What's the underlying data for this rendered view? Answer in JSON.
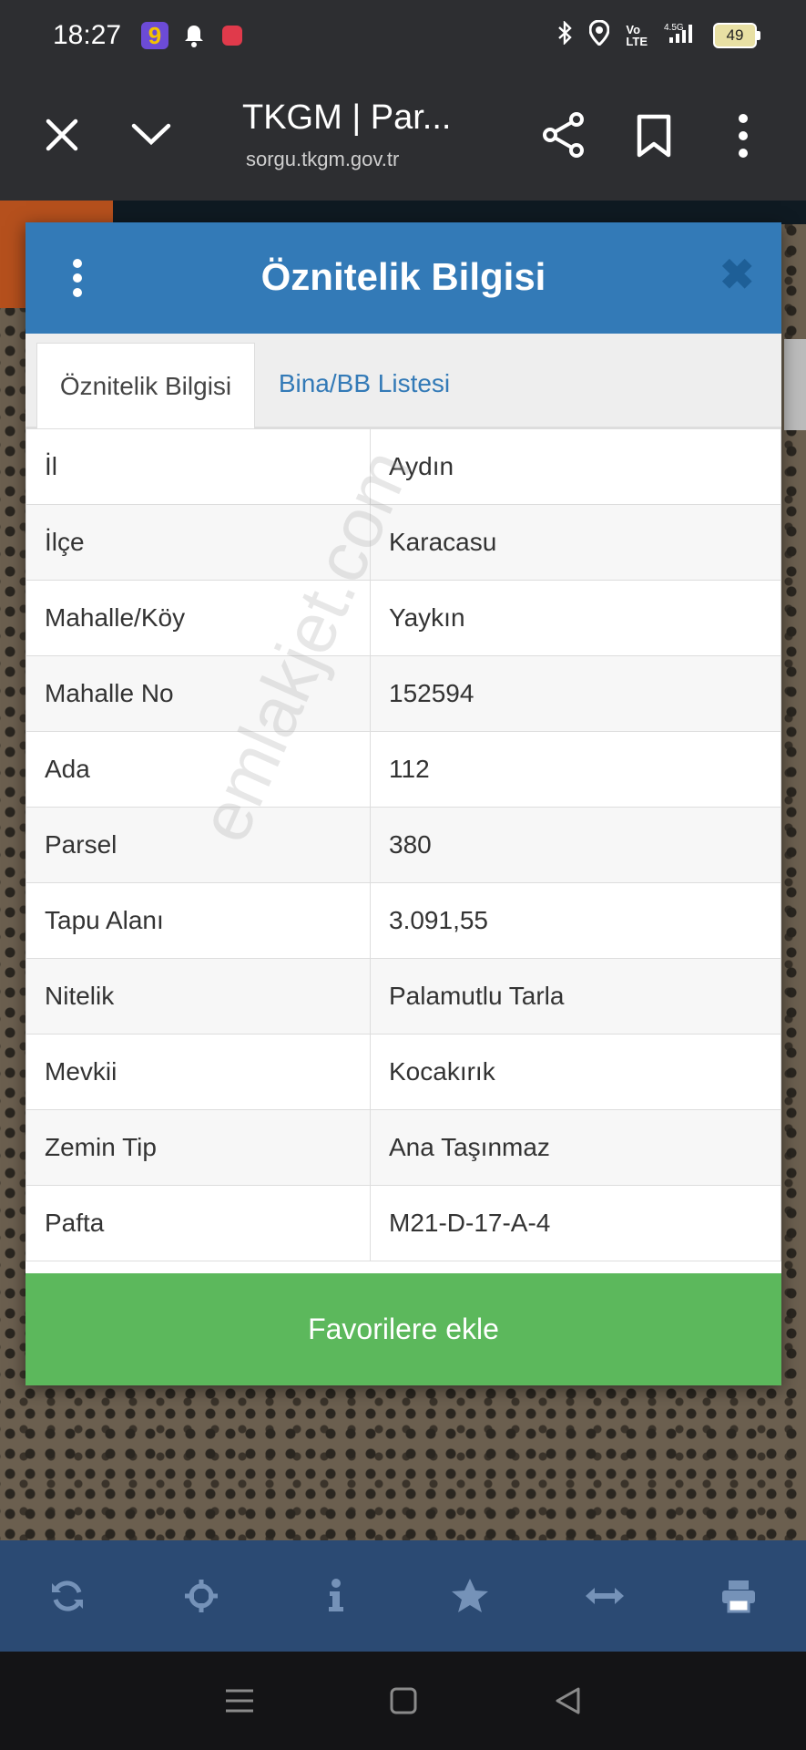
{
  "status": {
    "time": "18:27",
    "battery": "49"
  },
  "browser": {
    "title": "TKGM | Par...",
    "url": "sorgu.tkgm.gov.tr"
  },
  "dialog": {
    "title": "Öznitelik Bilgisi",
    "tabs": [
      {
        "label": "Öznitelik Bilgisi",
        "active": true
      },
      {
        "label": "Bina/BB Listesi",
        "active": false
      }
    ],
    "rows": [
      {
        "key": "İl",
        "value": "Aydın"
      },
      {
        "key": "İlçe",
        "value": "Karacasu"
      },
      {
        "key": "Mahalle/Köy",
        "value": "Yaykın"
      },
      {
        "key": "Mahalle No",
        "value": "152594"
      },
      {
        "key": "Ada",
        "value": "112"
      },
      {
        "key": "Parsel",
        "value": "380"
      },
      {
        "key": "Tapu Alanı",
        "value": "3.091,55"
      },
      {
        "key": "Nitelik",
        "value": "Palamutlu Tarla"
      },
      {
        "key": "Mevkii",
        "value": "Kocakırık"
      },
      {
        "key": "Zemin Tip",
        "value": "Ana Taşınmaz"
      },
      {
        "key": "Pafta",
        "value": "M21-D-17-A-4"
      }
    ],
    "favorite_label": "Favorilere ekle"
  },
  "watermark": "emlakjet.com",
  "toolbar": [
    "refresh-icon",
    "locate-icon",
    "info-icon",
    "star-icon",
    "measure-icon",
    "print-icon"
  ],
  "colors": {
    "header": "#337ab7",
    "button": "#5cb85c",
    "toolbar": "#2b4a73"
  }
}
